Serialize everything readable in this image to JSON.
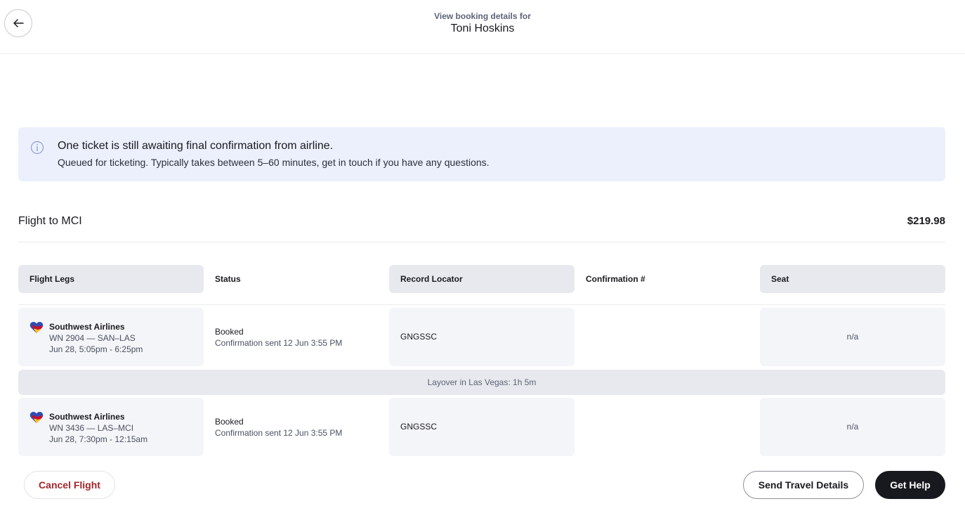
{
  "header": {
    "subtitle": "View booking details for",
    "title": "Toni Hoskins"
  },
  "alert": {
    "title": "One ticket is still awaiting final confirmation from airline.",
    "body": "Queued for ticketing. Typically takes between 5–60 minutes, get in touch if you have any questions."
  },
  "flight": {
    "title": "Flight to MCI",
    "price": "$219.98"
  },
  "columns": [
    "Flight Legs",
    "Status",
    "Record Locator",
    "Confirmation #",
    "Seat"
  ],
  "legs": [
    {
      "airline": "Southwest Airlines",
      "flight": "WN 2904 — SAN–LAS",
      "time": "Jun 28, 5:05pm - 6:25pm",
      "status": "Booked",
      "status_detail": "Confirmation sent 12 Jun 3:55 PM",
      "record_locator": "GNGSSC",
      "confirmation": "",
      "seat": "n/a"
    },
    {
      "airline": "Southwest Airlines",
      "flight": "WN 3436 — LAS–MCI",
      "time": "Jun 28, 7:30pm - 12:15am",
      "status": "Booked",
      "status_detail": "Confirmation sent 12 Jun 3:55 PM",
      "record_locator": "GNGSSC",
      "confirmation": "",
      "seat": "n/a"
    }
  ],
  "layover": "Layover in Las Vegas: 1h 5m",
  "buttons": {
    "cancel": "Cancel Flight",
    "send": "Send Travel Details",
    "help": "Get Help"
  },
  "colors": {
    "alert_bg": "#ebf0fc",
    "cancel_text": "#a3262b",
    "primary_button": "#18191f",
    "southwest_blue": "#304cb2",
    "southwest_red": "#c8102e",
    "southwest_yellow": "#ffbf27"
  },
  "icons": {
    "back": "arrow-left-icon",
    "alert": "info-circle-icon",
    "airline": "southwest-heart-logo"
  }
}
